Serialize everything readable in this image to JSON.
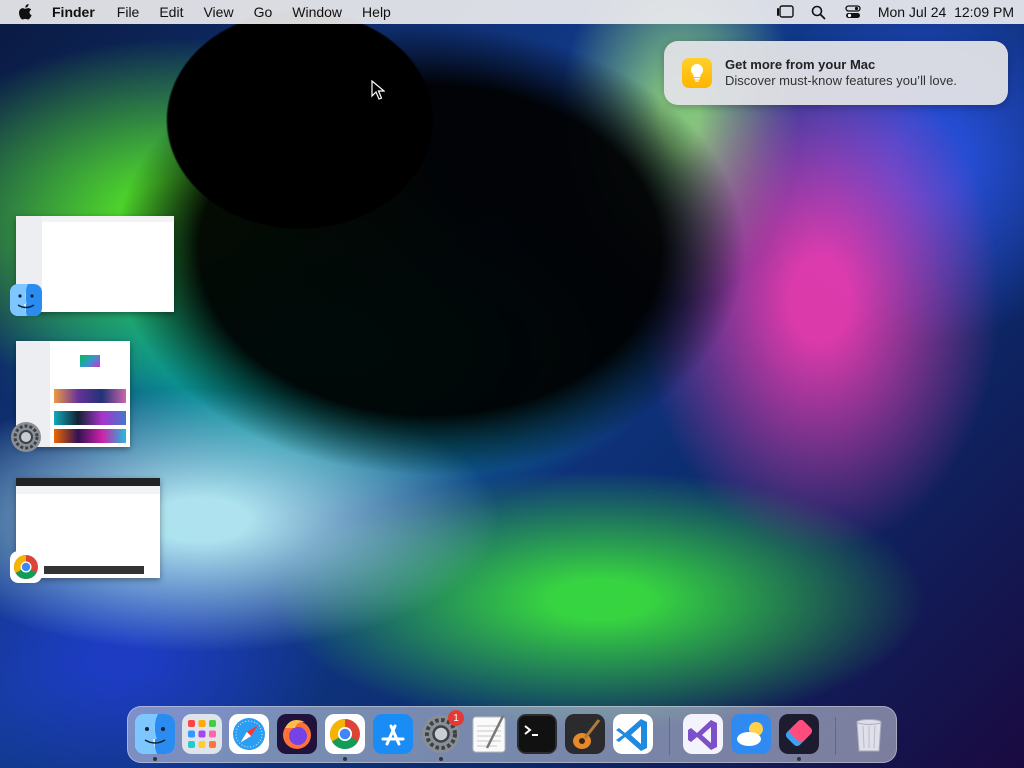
{
  "menubar": {
    "app_name": "Finder",
    "menus": [
      "File",
      "Edit",
      "View",
      "Go",
      "Window",
      "Help"
    ],
    "datetime": "Mon Jul 24  12:09 PM"
  },
  "notification": {
    "title": "Get more from your Mac",
    "body": "Discover must-know features you’ll love."
  },
  "stage_manager": {
    "windows": [
      {
        "app": "finder-icon"
      },
      {
        "app": "system-settings-icon"
      },
      {
        "app": "chrome-icon"
      }
    ]
  },
  "dock": {
    "items": [
      {
        "name": "finder-icon",
        "running": true
      },
      {
        "name": "launchpad-icon",
        "running": false
      },
      {
        "name": "safari-icon",
        "running": false
      },
      {
        "name": "firefox-icon",
        "running": false
      },
      {
        "name": "chrome-icon",
        "running": true
      },
      {
        "name": "app-store-icon",
        "running": false
      },
      {
        "name": "system-settings-icon",
        "running": true,
        "badge": "1"
      },
      {
        "name": "textedit-icon",
        "running": false
      },
      {
        "name": "terminal-icon",
        "running": false
      },
      {
        "name": "garageband-icon",
        "running": false
      },
      {
        "name": "vscode-icon",
        "running": false
      },
      {
        "name": "visual-studio-icon",
        "running": false
      },
      {
        "name": "weather-icon",
        "running": false
      },
      {
        "name": "shortcuts-icon",
        "running": true
      },
      {
        "name": "trash-icon",
        "running": false
      }
    ]
  },
  "colors": {
    "menubar_bg": "#ebebee",
    "notification_bg": "#e2e2e6",
    "badge_red": "#e53935"
  }
}
